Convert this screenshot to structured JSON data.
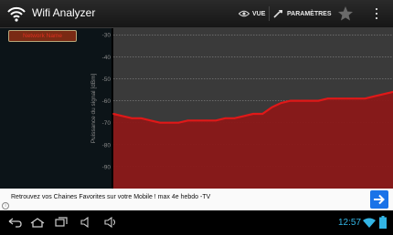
{
  "app": {
    "title": "Wifi Analyzer"
  },
  "actionbar": {
    "view_label": "VUE",
    "settings_label": "PARAMÈTRES"
  },
  "network_button": {
    "label": "Network Name"
  },
  "chart_data": {
    "type": "area",
    "ylabel": "Puissance du signal [dBm]",
    "yticks": [
      "-30",
      "-40",
      "-50",
      "-60",
      "-70",
      "-80",
      "-90"
    ],
    "ylim": [
      -100,
      -27
    ],
    "x": [
      0,
      1,
      2,
      3,
      4,
      5,
      6,
      7,
      8,
      9,
      10,
      11,
      12,
      13,
      14,
      15,
      16,
      17,
      18,
      19,
      20,
      21,
      22,
      23,
      24,
      25,
      26,
      27,
      28,
      29,
      30
    ],
    "series": [
      {
        "values": [
          -66,
          -67,
          -68,
          -68,
          -69,
          -70,
          -70,
          -70,
          -69,
          -69,
          -69,
          -69,
          -68,
          -68,
          -67,
          -66,
          -66,
          -63,
          -61,
          -60,
          -60,
          -60,
          -60,
          -59,
          -59,
          -59,
          -59,
          -59,
          -58,
          -57,
          -56
        ]
      }
    ],
    "line_color": "#e01818",
    "fill_color": "#8a1818",
    "grid": true
  },
  "ad": {
    "text": "Retrouvez vos Chaines Favorites sur votre Mobile ! max 4e hebdo -TV"
  },
  "status": {
    "time": "12:57"
  }
}
